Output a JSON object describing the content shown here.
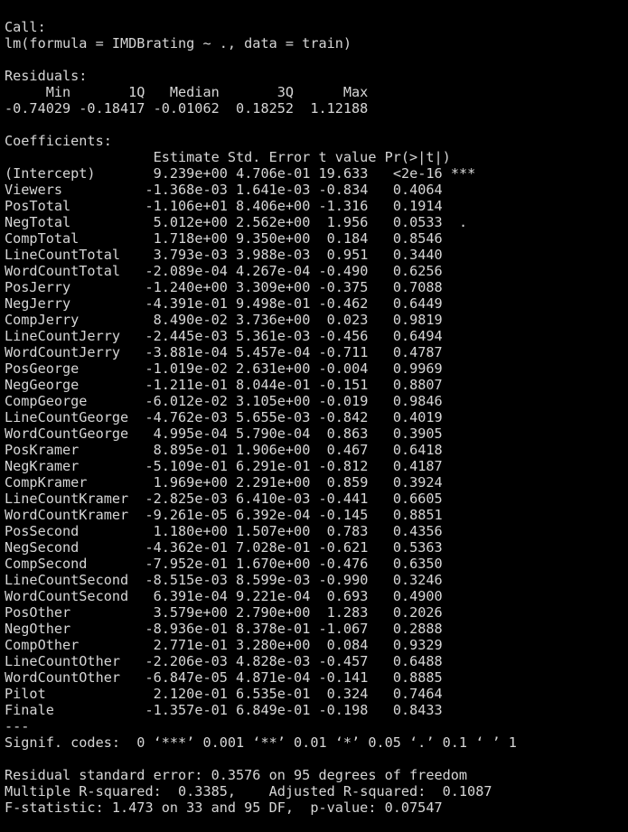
{
  "colors": {
    "background": "#000000",
    "text": "#d6d6d6"
  },
  "call": {
    "header": "Call:",
    "formula": "lm(formula = IMDBrating ~ ., data = train)"
  },
  "residuals": {
    "header": "Residuals:",
    "labels": "     Min       1Q   Median       3Q      Max ",
    "values": "-0.74029 -0.18417 -0.01062  0.18252  1.12188 "
  },
  "coefficients": {
    "header": "Coefficients:",
    "column_header": "                  Estimate Std. Error t value Pr(>|t|)    ",
    "rows": [
      {
        "name": "(Intercept)",
        "estimate": " 9.239e+00",
        "std_error": "4.706e-01",
        "t_value": "19.633",
        "p_value": "  <2e-16",
        "signif": "***"
      },
      {
        "name": "Viewers",
        "estimate": "-1.368e-03",
        "std_error": "1.641e-03",
        "t_value": "-0.834",
        "p_value": "  0.4064",
        "signif": ""
      },
      {
        "name": "PosTotal",
        "estimate": "-1.106e+01",
        "std_error": "8.406e+00",
        "t_value": "-1.316",
        "p_value": "  0.1914",
        "signif": ""
      },
      {
        "name": "NegTotal",
        "estimate": " 5.012e+00",
        "std_error": "2.562e+00",
        "t_value": " 1.956",
        "p_value": "  0.0533",
        "signif": " . "
      },
      {
        "name": "CompTotal",
        "estimate": " 1.718e+00",
        "std_error": "9.350e+00",
        "t_value": " 0.184",
        "p_value": "  0.8546",
        "signif": ""
      },
      {
        "name": "LineCountTotal",
        "estimate": " 3.793e-03",
        "std_error": "3.988e-03",
        "t_value": " 0.951",
        "p_value": "  0.3440",
        "signif": ""
      },
      {
        "name": "WordCountTotal",
        "estimate": "-2.089e-04",
        "std_error": "4.267e-04",
        "t_value": "-0.490",
        "p_value": "  0.6256",
        "signif": ""
      },
      {
        "name": "PosJerry",
        "estimate": "-1.240e+00",
        "std_error": "3.309e+00",
        "t_value": "-0.375",
        "p_value": "  0.7088",
        "signif": ""
      },
      {
        "name": "NegJerry",
        "estimate": "-4.391e-01",
        "std_error": "9.498e-01",
        "t_value": "-0.462",
        "p_value": "  0.6449",
        "signif": ""
      },
      {
        "name": "CompJerry",
        "estimate": " 8.490e-02",
        "std_error": "3.736e+00",
        "t_value": " 0.023",
        "p_value": "  0.9819",
        "signif": ""
      },
      {
        "name": "LineCountJerry",
        "estimate": "-2.445e-03",
        "std_error": "5.361e-03",
        "t_value": "-0.456",
        "p_value": "  0.6494",
        "signif": ""
      },
      {
        "name": "WordCountJerry",
        "estimate": "-3.881e-04",
        "std_error": "5.457e-04",
        "t_value": "-0.711",
        "p_value": "  0.4787",
        "signif": ""
      },
      {
        "name": "PosGeorge",
        "estimate": "-1.019e-02",
        "std_error": "2.631e+00",
        "t_value": "-0.004",
        "p_value": "  0.9969",
        "signif": ""
      },
      {
        "name": "NegGeorge",
        "estimate": "-1.211e-01",
        "std_error": "8.044e-01",
        "t_value": "-0.151",
        "p_value": "  0.8807",
        "signif": ""
      },
      {
        "name": "CompGeorge",
        "estimate": "-6.012e-02",
        "std_error": "3.105e+00",
        "t_value": "-0.019",
        "p_value": "  0.9846",
        "signif": ""
      },
      {
        "name": "LineCountGeorge",
        "estimate": "-4.762e-03",
        "std_error": "5.655e-03",
        "t_value": "-0.842",
        "p_value": "  0.4019",
        "signif": ""
      },
      {
        "name": "WordCountGeorge",
        "estimate": " 4.995e-04",
        "std_error": "5.790e-04",
        "t_value": " 0.863",
        "p_value": "  0.3905",
        "signif": ""
      },
      {
        "name": "PosKramer",
        "estimate": " 8.895e-01",
        "std_error": "1.906e+00",
        "t_value": " 0.467",
        "p_value": "  0.6418",
        "signif": ""
      },
      {
        "name": "NegKramer",
        "estimate": "-5.109e-01",
        "std_error": "6.291e-01",
        "t_value": "-0.812",
        "p_value": "  0.4187",
        "signif": ""
      },
      {
        "name": "CompKramer",
        "estimate": " 1.969e+00",
        "std_error": "2.291e+00",
        "t_value": " 0.859",
        "p_value": "  0.3924",
        "signif": ""
      },
      {
        "name": "LineCountKramer",
        "estimate": "-2.825e-03",
        "std_error": "6.410e-03",
        "t_value": "-0.441",
        "p_value": "  0.6605",
        "signif": ""
      },
      {
        "name": "WordCountKramer",
        "estimate": "-9.261e-05",
        "std_error": "6.392e-04",
        "t_value": "-0.145",
        "p_value": "  0.8851",
        "signif": ""
      },
      {
        "name": "PosSecond",
        "estimate": " 1.180e+00",
        "std_error": "1.507e+00",
        "t_value": " 0.783",
        "p_value": "  0.4356",
        "signif": ""
      },
      {
        "name": "NegSecond",
        "estimate": "-4.362e-01",
        "std_error": "7.028e-01",
        "t_value": "-0.621",
        "p_value": "  0.5363",
        "signif": ""
      },
      {
        "name": "CompSecond",
        "estimate": "-7.952e-01",
        "std_error": "1.670e+00",
        "t_value": "-0.476",
        "p_value": "  0.6350",
        "signif": ""
      },
      {
        "name": "LineCountSecond",
        "estimate": "-8.515e-03",
        "std_error": "8.599e-03",
        "t_value": "-0.990",
        "p_value": "  0.3246",
        "signif": ""
      },
      {
        "name": "WordCountSecond",
        "estimate": " 6.391e-04",
        "std_error": "9.221e-04",
        "t_value": " 0.693",
        "p_value": "  0.4900",
        "signif": ""
      },
      {
        "name": "PosOther",
        "estimate": " 3.579e+00",
        "std_error": "2.790e+00",
        "t_value": " 1.283",
        "p_value": "  0.2026",
        "signif": ""
      },
      {
        "name": "NegOther",
        "estimate": "-8.936e-01",
        "std_error": "8.378e-01",
        "t_value": "-1.067",
        "p_value": "  0.2888",
        "signif": ""
      },
      {
        "name": "CompOther",
        "estimate": " 2.771e-01",
        "std_error": "3.280e+00",
        "t_value": " 0.084",
        "p_value": "  0.9329",
        "signif": ""
      },
      {
        "name": "LineCountOther",
        "estimate": "-2.206e-03",
        "std_error": "4.828e-03",
        "t_value": "-0.457",
        "p_value": "  0.6488",
        "signif": ""
      },
      {
        "name": "WordCountOther",
        "estimate": "-6.847e-05",
        "std_error": "4.871e-04",
        "t_value": "-0.141",
        "p_value": "  0.8885",
        "signif": ""
      },
      {
        "name": "Pilot",
        "estimate": " 2.120e-01",
        "std_error": "6.535e-01",
        "t_value": " 0.324",
        "p_value": "  0.7464",
        "signif": ""
      },
      {
        "name": "Finale",
        "estimate": "-1.357e-01",
        "std_error": "6.849e-01",
        "t_value": "-0.198",
        "p_value": "  0.8433",
        "signif": ""
      }
    ],
    "separator": "---",
    "signif_codes": "Signif. codes:  0 ‘***’ 0.001 ‘**’ 0.01 ‘*’ 0.05 ‘.’ 0.1 ‘ ’ 1"
  },
  "summary": {
    "residual_se": "Residual standard error: 0.3576 on 95 degrees of freedom",
    "r_squared": "Multiple R-squared:  0.3385,\tAdjusted R-squared:  0.1087 ",
    "f_statistic": "F-statistic: 1.473 on 33 and 95 DF,  p-value: 0.07547"
  }
}
